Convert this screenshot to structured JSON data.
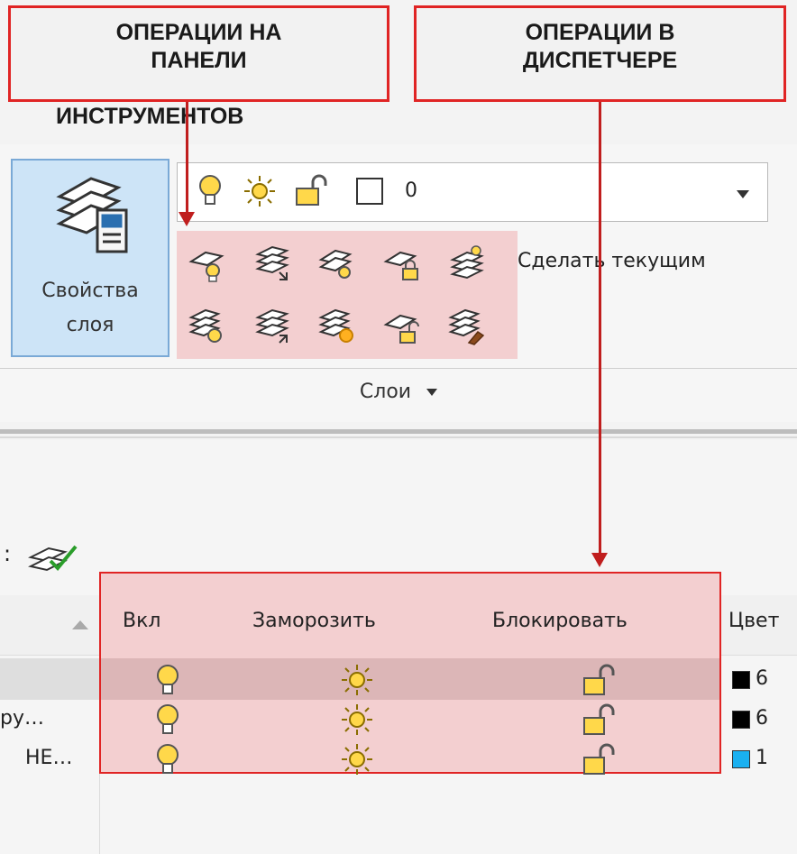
{
  "callouts": {
    "toolbar": {
      "line1": "ОПЕРАЦИИ НА",
      "line2": "ПАНЕЛИ",
      "line3": "ИНСТРУМЕНТОВ"
    },
    "manager": {
      "line1": "ОПЕРАЦИИ В",
      "line2": "ДИСПЕТЧЕРЕ"
    }
  },
  "ribbon": {
    "layer_props": {
      "line1": "Свойства",
      "line2": "слоя"
    },
    "combo_value": "0",
    "make_current": "Сделать текущим",
    "panel_title": "Слои"
  },
  "manager": {
    "columns": {
      "on": "Вкл",
      "freeze": "Заморозить",
      "lock": "Блокировать",
      "color": "Цвет"
    },
    "rows": [
      {
        "name": "",
        "color_hex": "#000000",
        "color_text": "6"
      },
      {
        "name": "ру…",
        "color_hex": "#000000",
        "color_text": "6"
      },
      {
        "name": "НЕ…",
        "color_hex": "#1ab0f0",
        "color_text": "1"
      }
    ]
  },
  "colors": {
    "callout_border": "#e02424",
    "highlight": "#f3cfd0",
    "arrow": "#c01e1e",
    "selected_button": "#cde4f7"
  }
}
